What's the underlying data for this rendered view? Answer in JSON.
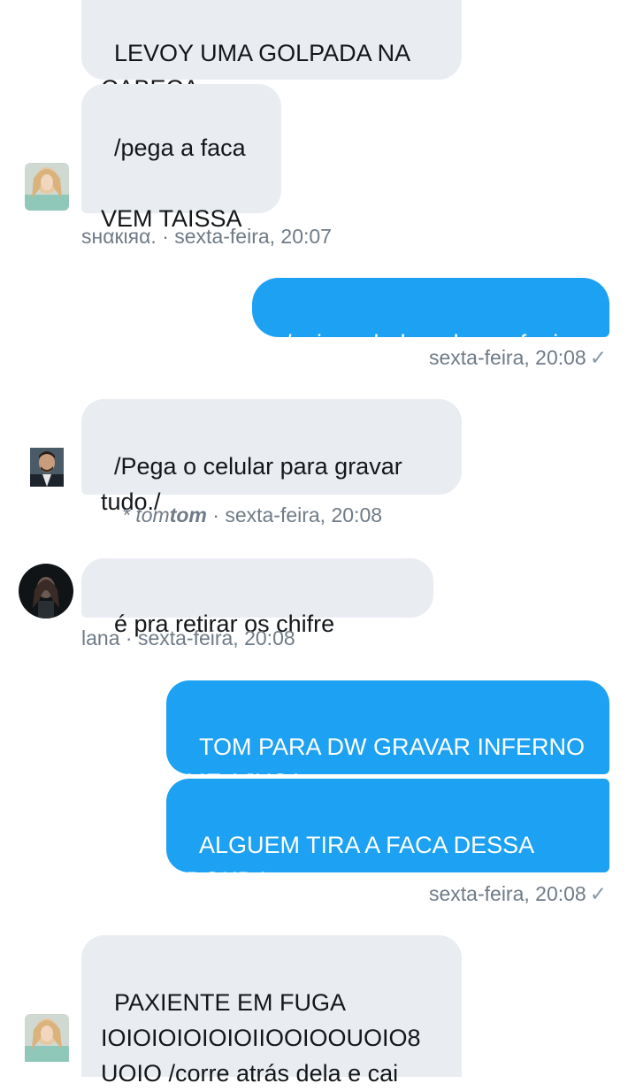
{
  "conversation": {
    "group1": {
      "msg1": "LEVOY UMA GOLPADA NA\nCABECA",
      "msg2": "/pega a faca\n\nVEM TAISSA",
      "sender": "ѕнαкιяα.",
      "time": "sexta-feira, 20:07"
    },
    "sent1": {
      "msg1": "/sai cambaleando pra fugir",
      "time": "sexta-feira, 20:08",
      "check": "✓"
    },
    "group2": {
      "msg1": "/Pega o celular para gravar\ntudo./",
      "sender_prefix": "* tom",
      "sender_bold": "tom",
      "time": "sexta-feira, 20:08"
    },
    "group3": {
      "msg1": "é pra retirar os chifre",
      "sender": "lana",
      "time": "sexta-feira, 20:08"
    },
    "sent2": {
      "msg1": "TOM PARA DW GRAVAR INFERNO\nME AJUSA",
      "msg2": "ALGUEM TIRA A FACA DESSA\nDOKDA",
      "time": "sexta-feira, 20:08",
      "check": "✓"
    },
    "group4": {
      "msg1": "PAXIENTE EM FUGA\nIOIOIOIOIOIOIIOOIOOUOIO8\nUOIO /corre atrás dela e cai"
    },
    "separator": " · "
  }
}
